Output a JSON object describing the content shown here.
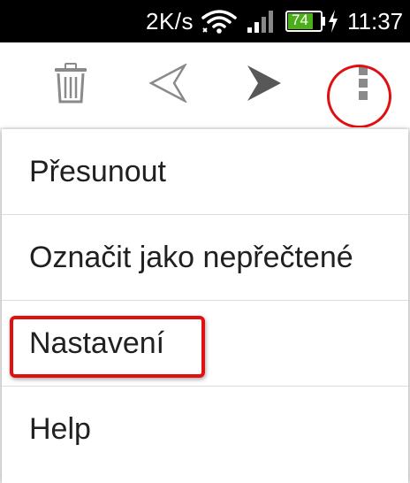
{
  "status_bar": {
    "speed": "2K/s",
    "battery_level": "74",
    "time": "11:37",
    "icons": [
      "wifi-icon",
      "signal-icon",
      "battery-icon",
      "charging-icon"
    ],
    "battery_color": "#4caf1a"
  },
  "toolbar": {
    "icons": [
      "trash-icon",
      "previous-icon",
      "next-icon",
      "more-options-icon"
    ],
    "icon_color": "#8a8a8a"
  },
  "menu": {
    "items": [
      {
        "label": "Přesunout"
      },
      {
        "label": "Označit jako nepřečtené"
      },
      {
        "label": "Nastavení"
      },
      {
        "label": "Help"
      }
    ]
  },
  "annotations": {
    "highlight_color": "#e01010"
  }
}
